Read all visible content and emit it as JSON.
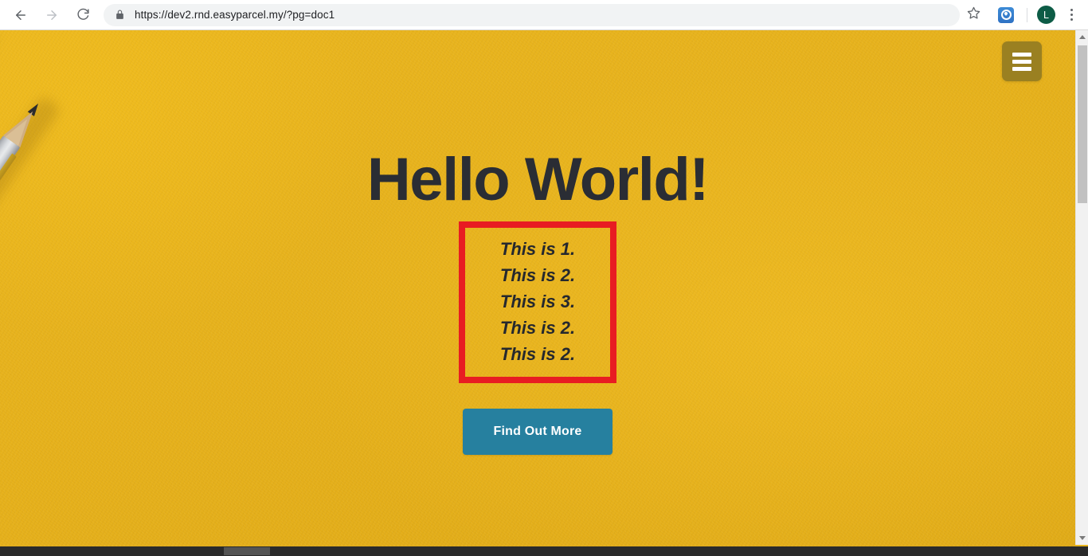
{
  "browser": {
    "back_icon": "back-arrow-icon",
    "forward_icon": "forward-arrow-icon",
    "reload_icon": "reload-icon",
    "lock_icon": "lock-icon",
    "url_secure_prefix": "https://",
    "url_domain": "dev2.rnd.easyparcel.my",
    "url_path": "/?pg=doc1",
    "url_full": "https://dev2.rnd.easyparcel.my/?pg=doc1",
    "star_icon": "bookmark-star-icon",
    "extension_icon": "extension-icon",
    "avatar_initial": "L",
    "menu_icon": "three-dot-menu-icon",
    "colors": {
      "omnibox_bg": "#f1f3f4",
      "avatar_bg": "#0d5c46",
      "extension_bg": "#3d8bd6"
    }
  },
  "page": {
    "nav": {
      "menu_toggle_icon": "hamburger-menu-icon",
      "menu_toggle_label": "Toggle navigation"
    },
    "hero": {
      "title": "Hello World!",
      "list_items": [
        "This is 1.",
        "This is 2.",
        "This is 3.",
        "This is 2.",
        "This is 2."
      ],
      "cta_label": "Find Out More",
      "background_image": "two-pencils-on-yellow-paper"
    },
    "colors": {
      "background_yellow": "#e8b41d",
      "title_dark": "#2a2d34",
      "list_border_red": "#e81c22",
      "cta_teal": "#26809f",
      "menu_button_olive": "#9a8021"
    }
  },
  "scrollbars": {
    "vertical_up_icon": "scroll-up-arrow-icon",
    "vertical_down_icon": "scroll-down-arrow-icon",
    "vertical_thumb": "vertical-scroll-thumb",
    "horizontal_thumb": "horizontal-scroll-thumb"
  }
}
